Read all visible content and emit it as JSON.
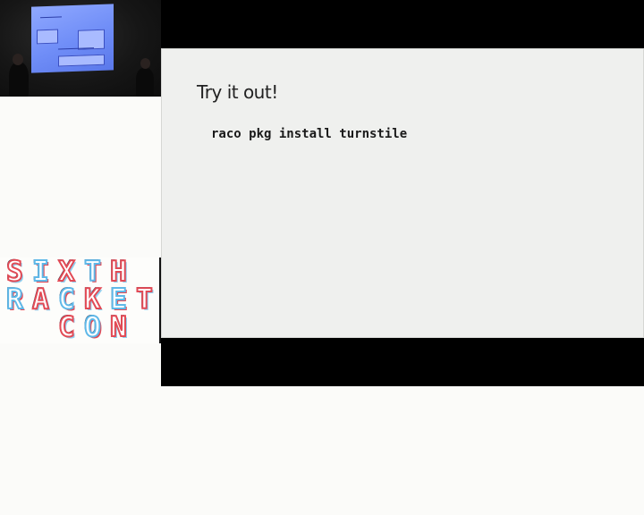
{
  "slide": {
    "title": "Try it out!",
    "code": "raco pkg install turnstile"
  },
  "logo": {
    "lines": [
      "SIXTH",
      "RACKET",
      "CON"
    ]
  },
  "camera": {
    "icon": "video-feed"
  },
  "colors": {
    "slide_bg": "#eff0ee",
    "frame_bg": "#000000",
    "logo_red": "#e24a55",
    "logo_blue": "#5fb8e8"
  }
}
